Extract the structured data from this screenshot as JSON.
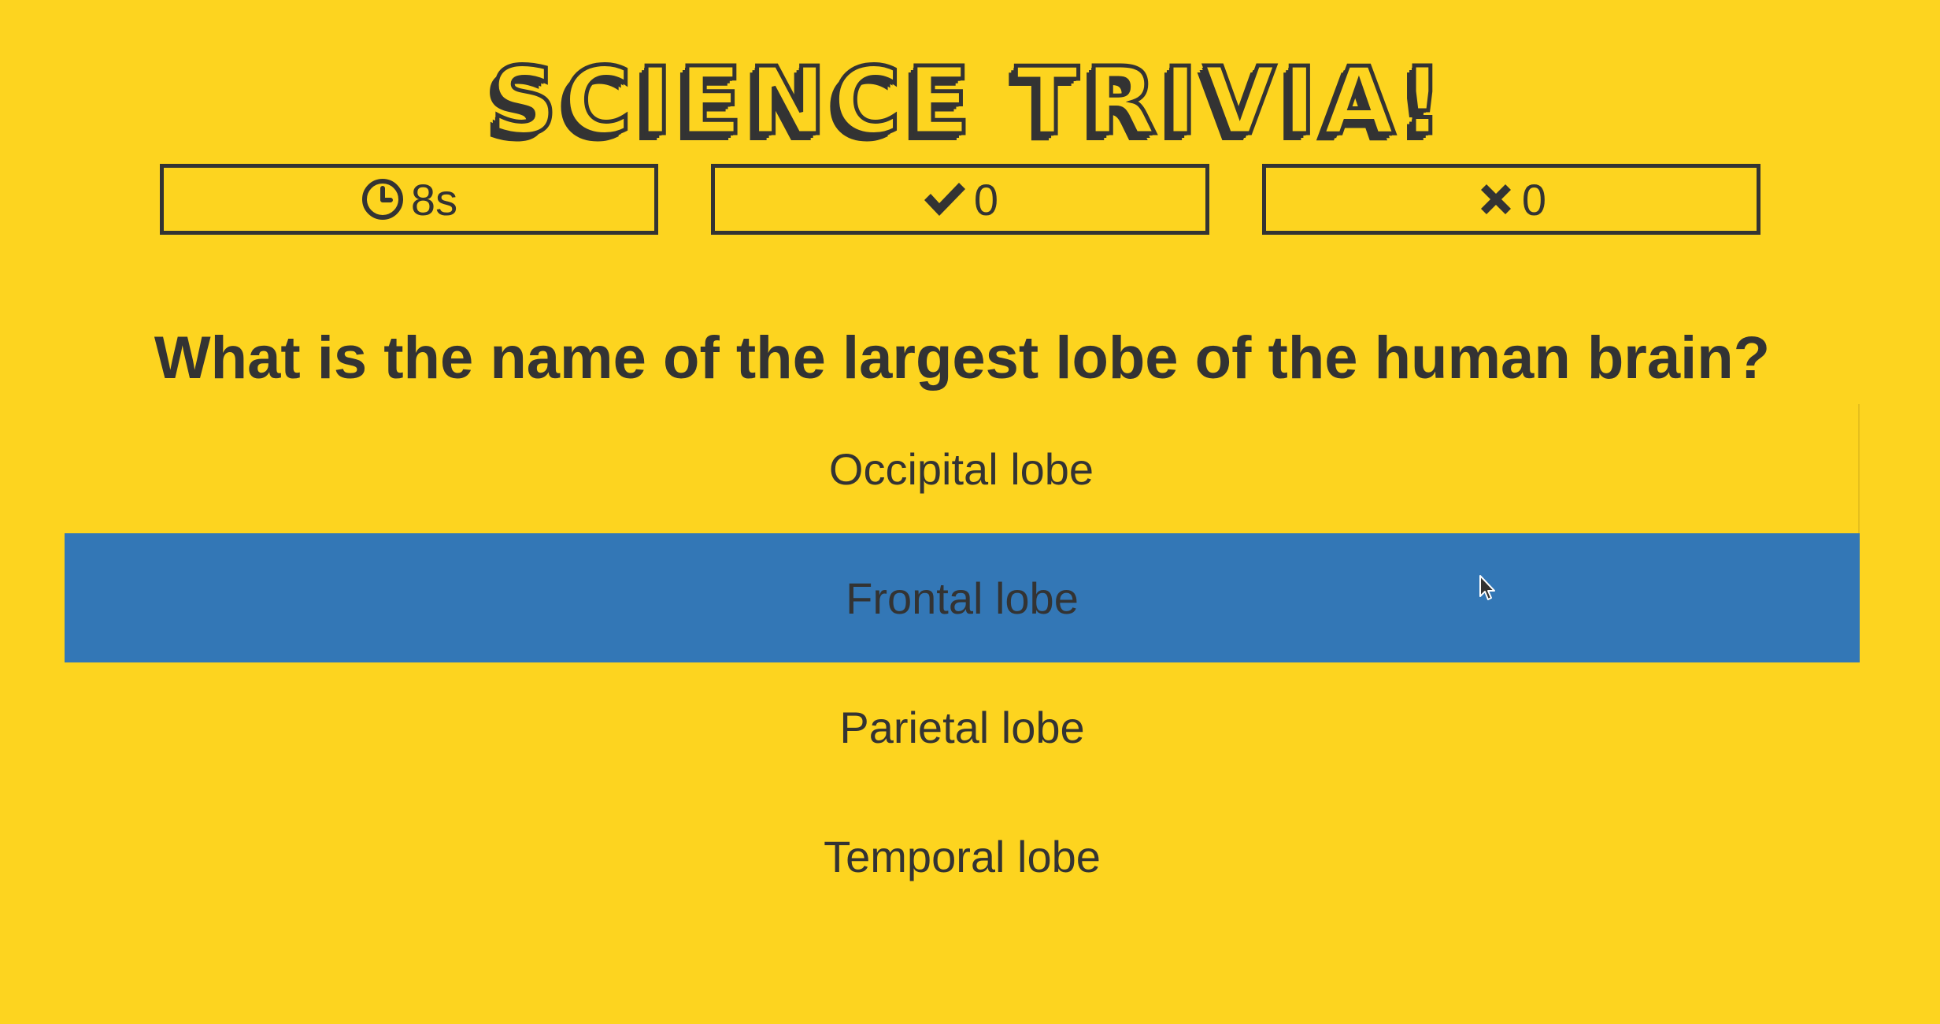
{
  "app": {
    "title": "Science Trivia!"
  },
  "stats": {
    "timer": {
      "icon": "clock-icon",
      "value": "8s"
    },
    "correct": {
      "icon": "checkmark-icon",
      "value": "0"
    },
    "wrong": {
      "icon": "x-icon",
      "value": "0"
    }
  },
  "question": {
    "text": "What is the name of the largest lobe of the human brain?"
  },
  "answers": [
    {
      "label": "Occipital lobe",
      "selected": false
    },
    {
      "label": "Frontal lobe",
      "selected": true
    },
    {
      "label": "Parietal lobe",
      "selected": false
    },
    {
      "label": "Temporal lobe",
      "selected": false
    }
  ],
  "colors": {
    "background": "#FDD41F",
    "text": "#333333",
    "highlight": "#3377B6"
  }
}
